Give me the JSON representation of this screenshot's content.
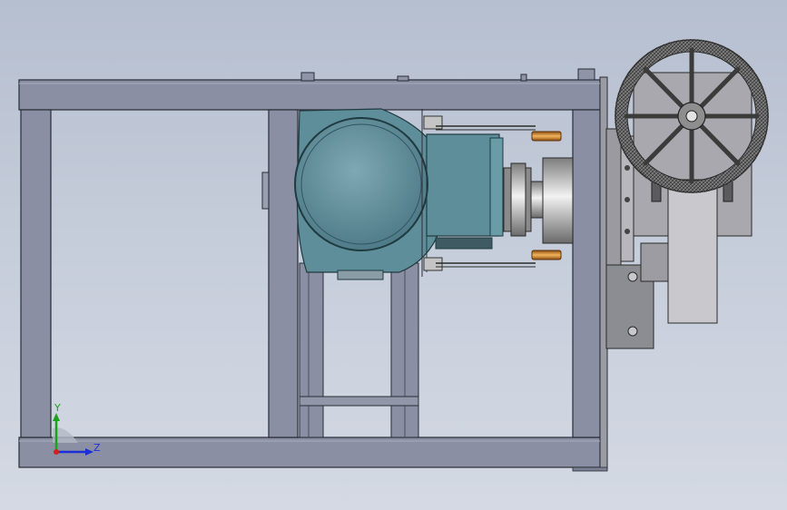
{
  "view": {
    "background_top": "#b6bfd0",
    "background_bottom": "#d4d9e3"
  },
  "colors": {
    "frame_fill": "#8a8fa3",
    "frame_stroke": "#2a2c36",
    "motor_fill": "#6d9aa6",
    "motor_dark": "#4f7a86",
    "gearbox_fill": "#5e8e99",
    "shaft_metal": "#c9c9c9",
    "bolt_orange": "#d98a2b",
    "wheel_dark": "#5a5a5a",
    "plate_gray": "#9b9ba3"
  },
  "triad": {
    "y_label": "Y",
    "z_label": "Z",
    "y_color": "#1aa31a",
    "z_color": "#1c2fd6",
    "x_color": "#d12020"
  },
  "icons": {
    "handwheel": "handwheel-icon",
    "motor": "motor-icon",
    "coordinate_triad": "axis-triad-icon"
  }
}
